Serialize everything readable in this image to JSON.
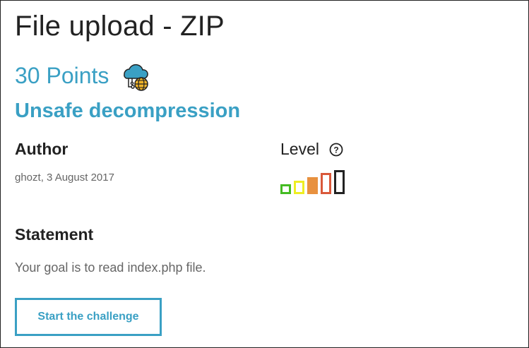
{
  "page": {
    "title": "File upload - ZIP",
    "points": "30 Points",
    "category_icon": "cloud-globe-icon",
    "subtitle": "Unsafe decompression"
  },
  "author": {
    "label": "Author",
    "meta": "ghozt,  3 August 2017"
  },
  "level": {
    "label": "Level",
    "help_icon": "question-circle-icon",
    "current": 3,
    "max": 5,
    "bar_colors": [
      "#44bb22",
      "#eeee22",
      "#e8913f",
      "#d9583a",
      "#222222"
    ]
  },
  "statement": {
    "label": "Statement",
    "text": "Your goal is to read index.php file."
  },
  "actions": {
    "start_label": "Start the challenge"
  },
  "colors": {
    "accent": "#3aa0c4"
  }
}
